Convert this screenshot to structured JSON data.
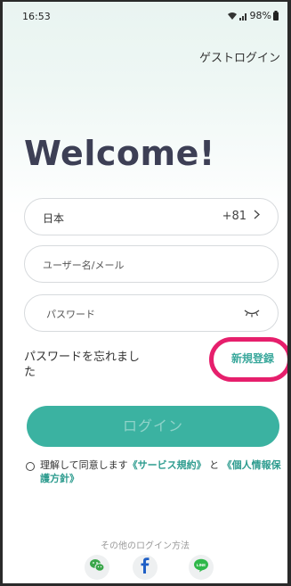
{
  "status_bar": {
    "time": "16:53",
    "battery": "98%"
  },
  "header": {
    "guest_login": "ゲストログイン"
  },
  "welcome": "Welcome!",
  "country_field": {
    "country": "日本",
    "code": "+81"
  },
  "username_field": {
    "placeholder": "ユーザー名/メール"
  },
  "password_field": {
    "placeholder": "パスワード"
  },
  "forgot_password": "パスワードを忘れました",
  "signup": "新規登録",
  "login_button": "ログイン",
  "agreement": {
    "prefix": "理解して同意します",
    "terms": "《サービス規約》",
    "and": "と",
    "privacy": "《個人情報保護方針》"
  },
  "other_login": {
    "label": "その他のログイン方法",
    "icons": [
      "wechat-icon",
      "facebook-icon",
      "line-icon"
    ]
  },
  "colors": {
    "accent": "#3bb2a1",
    "highlight_ring": "#e61f6c",
    "title": "#3d3f55"
  }
}
